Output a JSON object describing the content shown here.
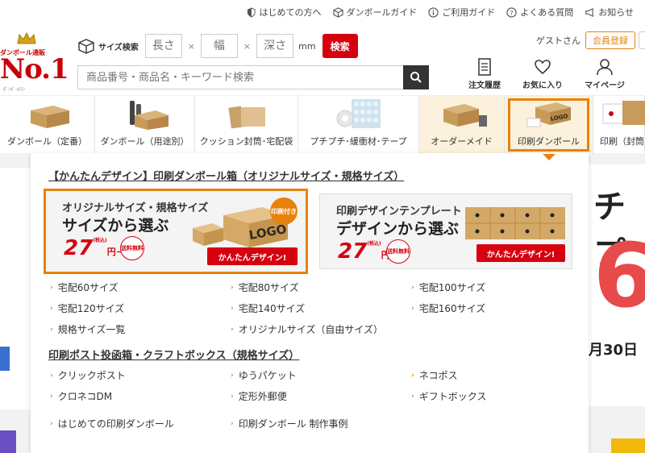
{
  "util_nav": [
    {
      "label": "はじめての方へ",
      "icon": "shield-icon"
    },
    {
      "label": "ダンボールガイド",
      "icon": "box-icon"
    },
    {
      "label": "ご利用ガイド",
      "icon": "info-icon"
    },
    {
      "label": "よくある質問",
      "icon": "question-icon"
    },
    {
      "label": "お知らせ",
      "icon": "megaphone-icon"
    }
  ],
  "logo": {
    "tagline": "ダンボール通販",
    "rank": "No.1",
    "sub": "ﾀﾞﾝﾎﾞｰﾙﾜﾝ"
  },
  "size_search": {
    "label": "サイズ検索",
    "length_placeholder": "長さ",
    "width_placeholder": "幅",
    "depth_placeholder": "深さ",
    "times": "×",
    "unit": "mm",
    "button": "検索"
  },
  "keyword_search": {
    "placeholder": "商品番号・商品名・キーワード検索"
  },
  "account": {
    "guest": "ゲストさん",
    "register": "会員登録",
    "order_history": "注文履歴",
    "favorites": "お気に入り",
    "mypage": "マイページ"
  },
  "categories": [
    {
      "label": "ダンボール（定番）"
    },
    {
      "label": "ダンボール（用途別）"
    },
    {
      "label": "クッション封筒･宅配袋"
    },
    {
      "label": "プチプチ･緩衝材･テープ"
    },
    {
      "label": "オーダーメイド"
    },
    {
      "label": "印刷ダンボール"
    },
    {
      "label": "印刷（封筒"
    }
  ],
  "menu": {
    "section1_title": "【かんたんデザイン】印刷ダンボール箱（オリジナルサイズ・規格サイズ）",
    "card1": {
      "title": "オリジナルサイズ・規格サイズ",
      "main": "サイズから選ぶ",
      "price": "27",
      "price_unit": "円~",
      "price_note": "(税込)",
      "free_shipping": "送料無料",
      "badge": "印刷付き",
      "logo_text": "LOGO",
      "button": "かんたんデザイン!"
    },
    "card2": {
      "title": "印刷デザインテンプレート",
      "main": "デザインから選ぶ",
      "price": "27",
      "price_unit": "円~",
      "price_note": "(税込)",
      "free_shipping": "送料無料",
      "button": "かんたんデザイン!"
    },
    "size_links": [
      "宅配60サイズ",
      "宅配80サイズ",
      "宅配100サイズ",
      "宅配120サイズ",
      "宅配140サイズ",
      "宅配160サイズ",
      "規格サイズ一覧",
      "オリジナルサイズ（自由サイズ）"
    ],
    "section2_title": "印刷ポスト投函箱・クラフトボックス（規格サイズ）",
    "post_links": [
      "クリックポスト",
      "ゆうパケット",
      "ネコポス",
      "クロネコDM",
      "定形外郵便",
      "ギフトボックス"
    ],
    "bottom_links": [
      "はじめての印刷ダンボール",
      "印刷ダンボール 制作事例"
    ]
  },
  "background": {
    "right_text": "チプ",
    "right_number": "6",
    "right_date": "月30日"
  },
  "colors": {
    "accent_red": "#d6000f",
    "accent_orange": "#e8820c"
  }
}
